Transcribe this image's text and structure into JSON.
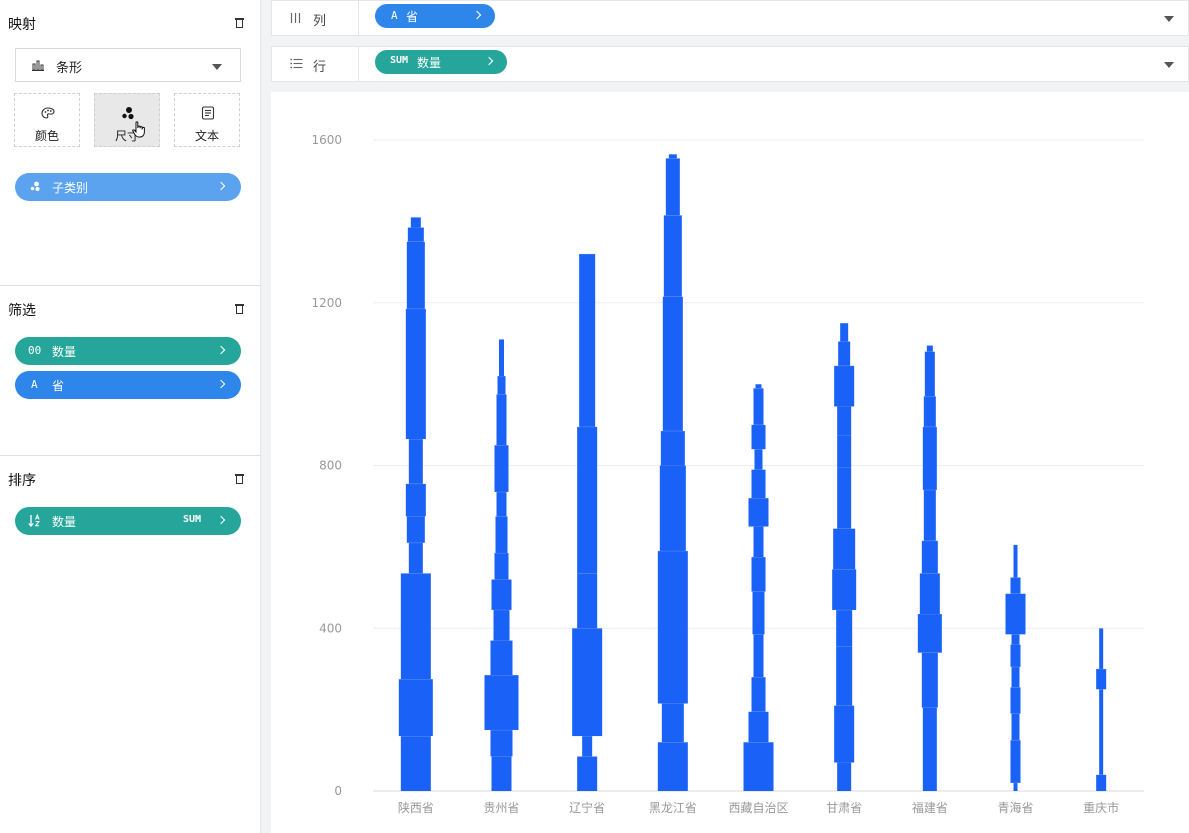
{
  "sidebar": {
    "mapping": {
      "title": "映射",
      "mark_type": "条形",
      "channels": [
        {
          "label": "颜色",
          "icon": "palette-icon"
        },
        {
          "label": "尺寸",
          "icon": "size-icon"
        },
        {
          "label": "文本",
          "icon": "text-icon"
        }
      ],
      "size_field": {
        "label": "子类别",
        "color": "#5ba3ef"
      }
    },
    "filter": {
      "title": "筛选",
      "fields": [
        {
          "icon_text": "00",
          "label": "数量",
          "color": "#26a69a"
        },
        {
          "icon_text": "A",
          "label": "省",
          "color": "#2f86ea"
        }
      ]
    },
    "sort": {
      "title": "排序",
      "field": {
        "label": "数量",
        "agg": "SUM",
        "color": "#26a69a"
      }
    }
  },
  "shelves": {
    "columns": {
      "label": "列",
      "pill_icon": "A",
      "pill_label": "省",
      "color": "#2f86ea"
    },
    "rows": {
      "label": "行",
      "pill_agg": "SUM",
      "pill_label": "数量",
      "color": "#26a69a"
    }
  },
  "colors": {
    "bar": "#1a62f7",
    "axis_text": "#999999",
    "grid": "#eeeeee"
  },
  "chart_data": {
    "type": "bar",
    "stacked": true,
    "ylim": [
      0,
      1600
    ],
    "yticks": [
      0,
      400,
      800,
      1200,
      1600
    ],
    "categories": [
      "陕西省",
      "贵州省",
      "辽宁省",
      "黑龙江省",
      "西藏自治区",
      "甘肃省",
      "福建省",
      "青海省",
      "重庆市"
    ],
    "stacks": [
      [
        [
          0,
          135,
          30
        ],
        [
          135,
          275,
          34
        ],
        [
          275,
          535,
          30
        ],
        [
          535,
          610,
          14
        ],
        [
          610,
          675,
          18
        ],
        [
          675,
          755,
          20
        ],
        [
          755,
          865,
          14
        ],
        [
          865,
          1185,
          20
        ],
        [
          1185,
          1350,
          18
        ],
        [
          1350,
          1385,
          16
        ],
        [
          1385,
          1410,
          10
        ]
      ],
      [
        [
          0,
          85,
          20
        ],
        [
          85,
          150,
          22
        ],
        [
          150,
          285,
          34
        ],
        [
          285,
          370,
          22
        ],
        [
          370,
          445,
          16
        ],
        [
          445,
          520,
          20
        ],
        [
          520,
          585,
          14
        ],
        [
          585,
          675,
          12
        ],
        [
          675,
          735,
          10
        ],
        [
          735,
          850,
          14
        ],
        [
          850,
          975,
          10
        ],
        [
          975,
          1020,
          8
        ],
        [
          1020,
          1110,
          5
        ]
      ],
      [
        [
          0,
          85,
          20
        ],
        [
          85,
          135,
          10
        ],
        [
          135,
          400,
          30
        ],
        [
          400,
          535,
          20
        ],
        [
          535,
          895,
          20
        ],
        [
          895,
          1320,
          16
        ]
      ],
      [
        [
          0,
          120,
          30
        ],
        [
          120,
          215,
          22
        ],
        [
          215,
          590,
          30
        ],
        [
          590,
          800,
          26
        ],
        [
          800,
          885,
          24
        ],
        [
          885,
          1215,
          20
        ],
        [
          1215,
          1415,
          18
        ],
        [
          1415,
          1555,
          14
        ],
        [
          1555,
          1565,
          8
        ]
      ],
      [
        [
          0,
          120,
          30
        ],
        [
          120,
          195,
          20
        ],
        [
          195,
          280,
          14
        ],
        [
          280,
          385,
          10
        ],
        [
          385,
          490,
          12
        ],
        [
          490,
          575,
          14
        ],
        [
          575,
          650,
          10
        ],
        [
          650,
          720,
          20
        ],
        [
          720,
          790,
          14
        ],
        [
          790,
          840,
          8
        ],
        [
          840,
          900,
          14
        ],
        [
          900,
          990,
          10
        ],
        [
          990,
          1000,
          6
        ]
      ],
      [
        [
          0,
          70,
          14
        ],
        [
          70,
          210,
          20
        ],
        [
          210,
          355,
          16
        ],
        [
          355,
          445,
          16
        ],
        [
          445,
          545,
          24
        ],
        [
          545,
          645,
          22
        ],
        [
          645,
          795,
          14
        ],
        [
          795,
          875,
          14
        ],
        [
          875,
          945,
          14
        ],
        [
          945,
          1045,
          20
        ],
        [
          1045,
          1105,
          12
        ],
        [
          1105,
          1150,
          8
        ]
      ],
      [
        [
          0,
          205,
          14
        ],
        [
          205,
          340,
          16
        ],
        [
          340,
          435,
          24
        ],
        [
          435,
          535,
          20
        ],
        [
          535,
          615,
          16
        ],
        [
          615,
          740,
          12
        ],
        [
          740,
          895,
          14
        ],
        [
          895,
          970,
          12
        ],
        [
          970,
          1080,
          10
        ],
        [
          1080,
          1095,
          6
        ]
      ],
      [
        [
          0,
          20,
          4
        ],
        [
          20,
          125,
          10
        ],
        [
          125,
          190,
          8
        ],
        [
          190,
          255,
          10
        ],
        [
          255,
          305,
          8
        ],
        [
          305,
          360,
          10
        ],
        [
          360,
          385,
          8
        ],
        [
          385,
          485,
          20
        ],
        [
          485,
          525,
          10
        ],
        [
          525,
          605,
          4
        ]
      ],
      [
        [
          0,
          40,
          10
        ],
        [
          40,
          250,
          4
        ],
        [
          250,
          300,
          10
        ],
        [
          300,
          400,
          4
        ]
      ]
    ]
  }
}
